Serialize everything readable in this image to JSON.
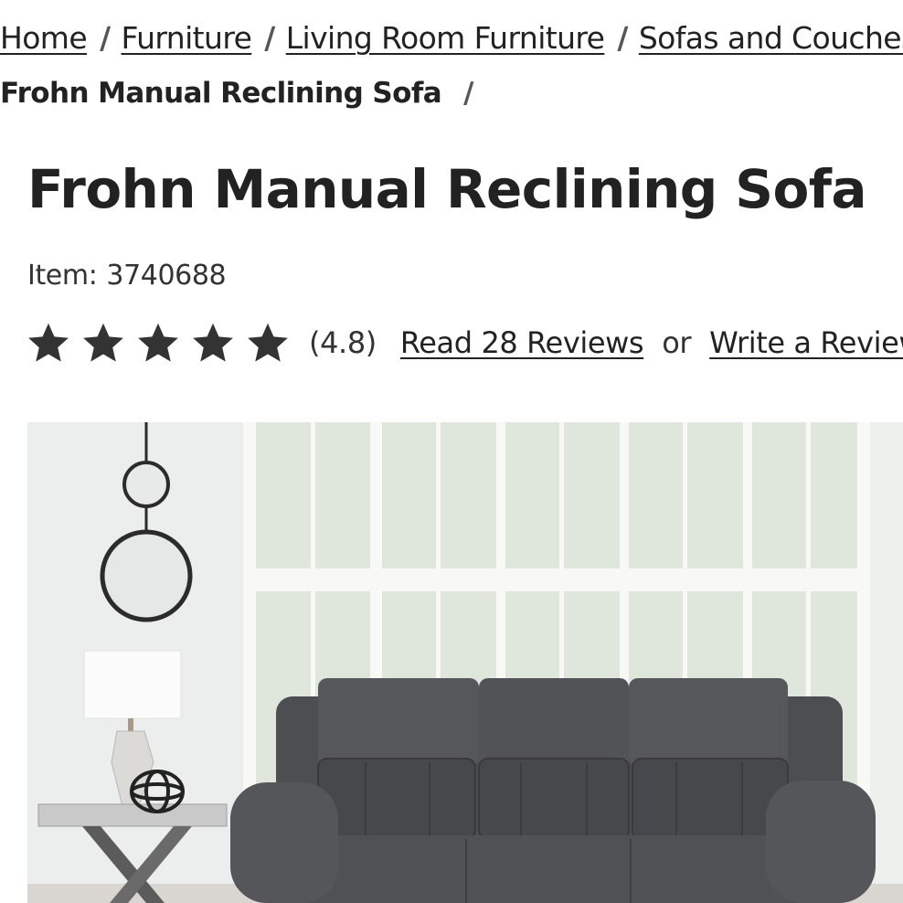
{
  "breadcrumb": {
    "items": [
      "Home",
      "Furniture",
      "Living Room Furniture",
      "Sofas and Couches"
    ],
    "separator": "/",
    "current": "Frohn Manual Reclining Sofa"
  },
  "product": {
    "title": "Frohn Manual Reclining Sofa",
    "item_label": "Item:",
    "item_number": "3740688",
    "rating_value": 4.8,
    "rating_text": "(4.8)",
    "stars_total": 5,
    "read_reviews": "Read 28 Reviews",
    "or_text": "or",
    "write_review": "Write a Review"
  },
  "image": {
    "subject": "gray reclining sofa in a bright living room"
  },
  "colors": {
    "text": "#222222",
    "star": "#333333",
    "sofa": "#4a4a4d",
    "wall": "#f1f2f1"
  },
  "icons": [
    "star-icon",
    "lamp-icon",
    "mirror-icon",
    "orb-sculpture-icon"
  ]
}
